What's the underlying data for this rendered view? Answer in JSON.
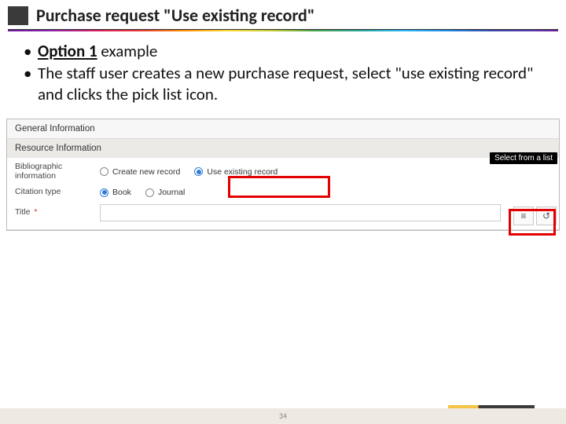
{
  "header": {
    "title": "Purchase request \"Use existing record\""
  },
  "bullets": {
    "b1_strong": "Option 1",
    "b1_rest": " example",
    "b2": "The staff user creates a new purchase request, select \"use existing record\" and clicks the pick list icon."
  },
  "form": {
    "section_general": "General Information",
    "section_resource": "Resource Information",
    "biblio_label": "Bibliographic information",
    "radio_create": "Create new record",
    "radio_existing": "Use existing record",
    "citation_label": "Citation type",
    "radio_book": "Book",
    "radio_journal": "Journal",
    "title_label": "Title",
    "required_mark": "*",
    "tooltip": "Select from a list",
    "icon_list_glyph": "≡",
    "icon_history_glyph": "↺"
  },
  "footer": {
    "page": "34"
  }
}
